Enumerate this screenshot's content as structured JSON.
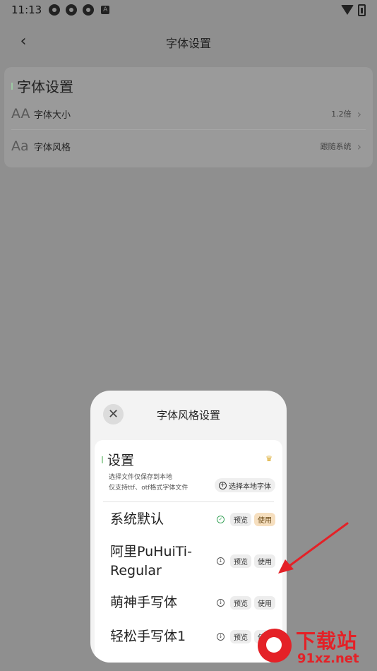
{
  "status_bar": {
    "time": "11:13",
    "notification_icons": [
      "app-icon",
      "app-icon",
      "app-icon",
      "a-icon"
    ],
    "a_icon_label": "A"
  },
  "header": {
    "back_glyph": "‹",
    "title": "字体设置"
  },
  "settings_card": {
    "title": "字体设置",
    "rows": [
      {
        "icon_text": "AA",
        "label": "字体大小",
        "value": "1.2倍"
      },
      {
        "icon_text": "Aa",
        "label": "字体风格",
        "value": "跟随系统"
      }
    ]
  },
  "sheet": {
    "title": "字体风格设置",
    "close_glyph": "✕",
    "section_title": "设置",
    "desc_line1": "选择文件仅保存到本地",
    "desc_line2": "仅支持ttf、otf格式字体文件",
    "local_button": "选择本地字体",
    "fonts": [
      {
        "name": "系统默认",
        "status": "selected",
        "preview": "预览",
        "use": "使用"
      },
      {
        "name": "阿里PuHuiTi-Regular",
        "status": "download",
        "preview": "预览",
        "use": "使用"
      },
      {
        "name": "萌神手写体",
        "status": "download",
        "preview": "预览",
        "use": "使用"
      },
      {
        "name": "轻松手写体1",
        "status": "download",
        "preview": "预览",
        "use": "使用"
      }
    ]
  },
  "watermark": {
    "text": "下载站",
    "url": "91xz.net"
  },
  "colors": {
    "overlay_bg": "#8f8f8f",
    "sheet_bg": "#f3f3f3",
    "active_pill": "#f6dfbf",
    "arrow": "#e42127",
    "accent_green": "#3aa35a"
  }
}
